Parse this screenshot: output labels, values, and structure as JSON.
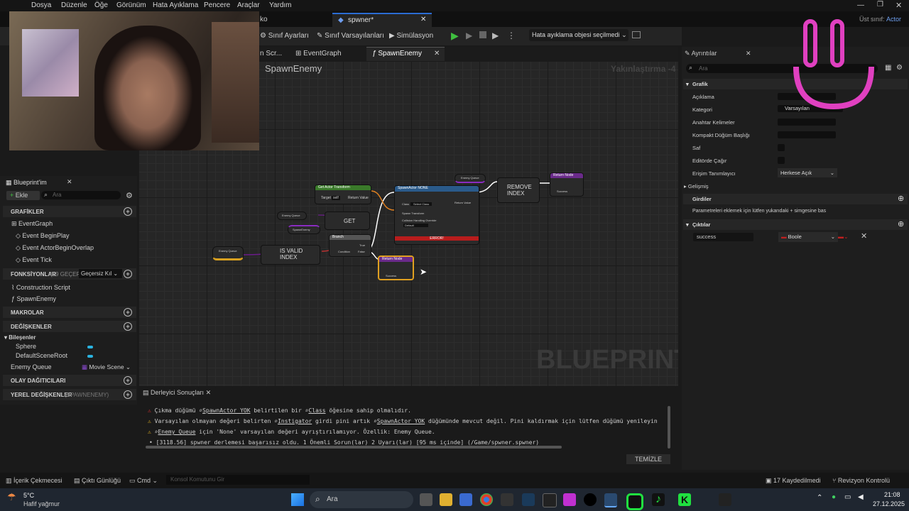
{
  "menu": [
    "Dosya",
    "Düzenle",
    "Öğe",
    "Görünüm",
    "Hata Ayıklama",
    "Pencere",
    "Araçlar",
    "Yardım"
  ],
  "parent_class": {
    "label": "Üst sınıf:",
    "value": "Actor"
  },
  "doc_tabs": {
    "left_partial": "ko",
    "active": "spwner*"
  },
  "toolbar": {
    "class_settings": "Sınıf Ayarları",
    "class_defaults": "Sınıf Varsayılanları",
    "simulation": "Simülasyon",
    "debug_object": "Hata ayıklama objesi seçilmedi"
  },
  "graph_tabs": {
    "partial": "n Scr...",
    "event_graph": "EventGraph",
    "spawn_enemy": "SpawnEnemy"
  },
  "graph": {
    "title": "SpawnEnemy",
    "zoom": "Yakınlaştırma -4",
    "watermark": "BLUEPRINT",
    "nodes": {
      "get_actor_transform": "Get Actor Transform",
      "target": "Target",
      "self": "self",
      "return_value": "Return Value",
      "enemy_queue": "Enemy Queue",
      "spawn_enemy_var": "SpawnEnemy",
      "get": "GET",
      "is_valid_index": "IS VALID INDEX",
      "branch": "Branch",
      "condition": "Condition",
      "true": "True",
      "false": "False",
      "spawn_actor": "SpawnActor NONE",
      "class": "Class",
      "select_class": "Select Class",
      "spawn_transform": "Spawn Transform",
      "collision": "Collision Handling Override",
      "default": "Default",
      "error": "ERROR!",
      "remove_index": "REMOVE INDEX",
      "return_node": "Return Node",
      "success": "Success"
    }
  },
  "myblueprint": {
    "tab": "Blueprint'im",
    "add": "Ekle",
    "search_placeholder": "Ara",
    "graphs_header": "GRAFİKLER",
    "event_graph": "EventGraph",
    "events": [
      "Event BeginPlay",
      "Event ActorBeginOverlap",
      "Event Tick"
    ],
    "functions_header": "FONKSİYONLAR",
    "functions_count": "(19 GEÇERSİ",
    "override_label": "Geçersiz Kıl",
    "functions": [
      "Construction Script",
      "SpawnEnemy"
    ],
    "macros_header": "MAKROLAR",
    "variables_header": "DEĞİŞKENLER",
    "components_header": "Bileşenler",
    "components": [
      "Sphere",
      "DefaultSceneRoot"
    ],
    "enemy_queue": "Enemy Queue",
    "enemy_queue_type": "Movie Scene",
    "dispatchers_header": "OLAY DAĞITICILARI",
    "local_vars_header": "YEREL DEĞİŞKENLER",
    "local_vars_scope": "(SPAWNENEMY)"
  },
  "details": {
    "tab": "Ayrıntılar",
    "search_placeholder": "Ara",
    "graph_header": "Grafik",
    "rows": [
      "Açıklama",
      "Kategori",
      "Anahtar Kelimeler",
      "Kompakt Düğüm Başlığı",
      "Saf",
      "Editörde Çağır",
      "Erişim Tanımlayıcı"
    ],
    "category_value": "Varsayılan",
    "access_value": "Herkese Açık",
    "advanced": "Gelişmiş",
    "inputs_header": "Girdiler",
    "inputs_hint": "Parametreleri eklemek için lütfen yukarıdaki + simgesine bas",
    "outputs_header": "Çıktılar",
    "output_name": "success",
    "output_type": "Boole"
  },
  "compiler": {
    "tab": "Derleyici Sonuçları",
    "lines": [
      {
        "icon": "error",
        "parts": [
          "Çıkma düğümü ",
          "SpawnActor YOK",
          " belirtilen bir ",
          "Class",
          " öğesine sahip olmalıdır."
        ]
      },
      {
        "icon": "warning",
        "parts": [
          "Varsayılan olmayan değeri belirten ",
          "Instigator",
          " girdi pini artık ",
          "SpawnActor YOK",
          " düğümünde mevcut değil. Pini kaldırmak için lütfen düğümü yenileyin"
        ]
      },
      {
        "icon": "warning",
        "parts": [
          "",
          "Enemy Queue",
          " için 'None' varsayılan değeri ayrıştırılamıyor. Özellik: Enemy Queue."
        ]
      },
      {
        "icon": "bullet",
        "parts": [
          "[3118.56] spwner derlemesi başarısız oldu. 1 Önemli Sorun(lar) 2 Uyarı(lar) [95 ms içinde] (/Game/spwner.spwner)"
        ]
      }
    ],
    "clear": "TEMİZLE"
  },
  "bottombar": {
    "content_drawer": "İçerik Çekmecesi",
    "output_log": "Çıktı Günlüğü",
    "cmd": "Cmd",
    "console_placeholder": "Konsol Komutunu Gir",
    "saved": "17 Kaydedilmedi",
    "revision": "Revizyon Kontrolü"
  },
  "taskbar": {
    "temp": "5°C",
    "weather": "Hafif yağmur",
    "search": "Ara",
    "time": "21:08",
    "date": "27.12.2025"
  }
}
